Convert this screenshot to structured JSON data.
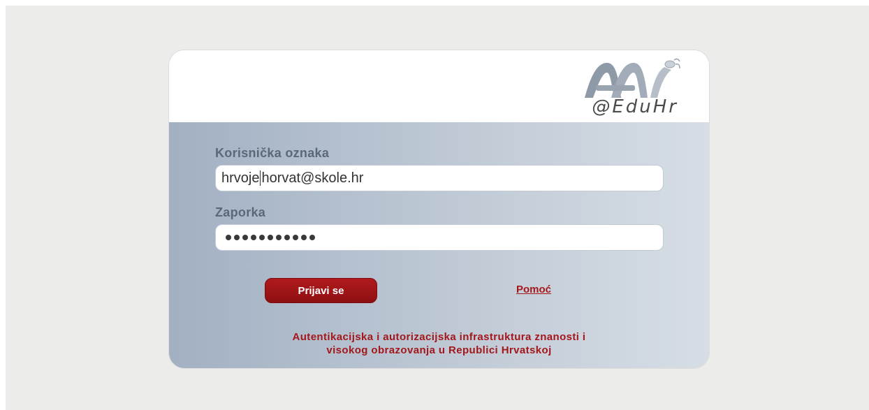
{
  "logo": {
    "icon": "aai-logo",
    "text": "@EduHr"
  },
  "form": {
    "username_label": "Korisnička oznaka",
    "username_value_before_caret": "hrvoje",
    "username_value_after_caret": "horvat@skole.hr",
    "password_label": "Zaporka",
    "password_length": 11
  },
  "actions": {
    "login_label": "Prijavi se",
    "help_label": "Pomoć"
  },
  "footer": {
    "line1": "Autentikacijska i autorizacijska infrastruktura znanosti i",
    "line2": "visokog obrazovanja u Republici Hrvatskoj"
  },
  "colors": {
    "accent_red": "#a3171b",
    "button_red": "#9e1418",
    "panel_blue_gray": "#b5c1cf"
  }
}
